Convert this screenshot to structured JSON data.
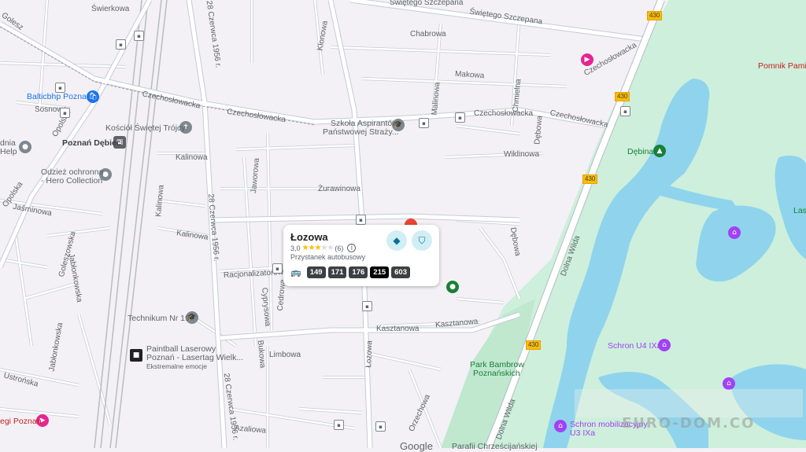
{
  "streets": {
    "swierkowa": "Świerkowa",
    "sw_szczepana_1": "Świętego Szczepana",
    "sw_szczepana_2": "Świętego Szczepana",
    "chabrowa": "Chabrowa",
    "klonowa": "Klonowa",
    "czerwca_top": "28 Czerwca 1956 r.",
    "makowa": "Makowa",
    "malinowa": "Malinowa",
    "chmielna": "Chmielna",
    "czechoslowacka_1": "Czechosłowacka",
    "czechoslowacka_2": "Czechosłowacka",
    "czechoslowacka_3": "Czechosłowacka",
    "czechoslowacka_4": "Czechosłowacka",
    "czechoslowacka_5": "Czechosłowacka",
    "sosnowa": "Sosnowa",
    "opolska_1": "Opolska",
    "opolska_2": "Opolska",
    "kalinowa_1": "Kalinowa",
    "kalinowa_2": "Kalinowa",
    "kalinowa_3": "Kalinowa",
    "jaworowa": "Jaworowa",
    "zurawinowa": "Żurawinowa",
    "wiklinowa": "Wiklinowa",
    "debowa_1": "Dębowa",
    "debowa_2": "Dębowa",
    "jasminowa": "Jaśminowa",
    "goleszowska": "Goleszowska",
    "jablonkowska_1": "Jabłonkowska",
    "jablonkowska_2": "Jabłonkowska",
    "czerwca_mid": "28 Czerwca 1956 r.",
    "czerwca_low": "28 Czerwca 1956 r.",
    "racjonalizatorow": "Racjonalizatorów",
    "cedrowa": "Cedrowa",
    "cyprysowa": "Cyprysowa",
    "kasztanowa_1": "Kasztanowa",
    "kasztanowa_2": "Kasztanowa",
    "lozowa_vertical": "Łozowa",
    "bukowa": "Bukowa",
    "limbowa": "Limbowa",
    "ustronska": "Ustrońska",
    "azaliowa": "Azaliowa",
    "orzechowa": "Orzechowa",
    "dolna_wilda_1": "Dolna Wilda",
    "dolna_wilda_2": "Dolna Wilda",
    "road_430_a": "430",
    "road_430_b": "430",
    "road_430_c": "430",
    "road_430_d": "430",
    "golesz_top": "Golesz"
  },
  "pois": {
    "balticbhp": "Balticbhp Poznań",
    "kosciol": "Kościół Świętej Trójcy",
    "poznan_debiec": "Poznań Dębiec",
    "odziez_1": "Odzież ochronna",
    "odziez_2": "- Hero Collection",
    "help_1": "dnia",
    "help_2": "Help",
    "szkola_1": "Szkoła Aspirantów",
    "szkola_2": "Państwowej Straży...",
    "pomnik": "Pomnik Pamię",
    "debina": "Dębina",
    "las": "Las",
    "technikum": "Technikum Nr 19",
    "paintball_1": "Paintball Laserowy",
    "paintball_2": "Poznań - Lasertag Wielk...",
    "paintball_3": "Ekstremalne emocje",
    "park_1": "Park Bambrow",
    "park_2": "Poznańskich",
    "schron_u4": "Schron U4 IXa",
    "schron_mob_1": "Schron mobilizacyjny",
    "schron_mob_2": "U3 IXa",
    "egi_poznan": "egi Poznań",
    "parafia": "Parafii Chrześcijańskiej"
  },
  "card": {
    "title": "Łozowa",
    "rating": "3,0",
    "stars_filled": 3,
    "stars_total": 5,
    "stars_filled_text": "★★★",
    "stars_empty_text": "★★",
    "reviews": "(6)",
    "type": "Przystanek autobusowy",
    "routes": [
      "149",
      "171",
      "176",
      "215",
      "603"
    ],
    "active_route": "215"
  },
  "watermark": "EURO-DOM.CO",
  "google": "Google",
  "colors": {
    "park": "#cdefdc",
    "water": "#8fd4ec",
    "road": "#ffffff",
    "road_casing": "#c6cbd2",
    "pin_red": "#ea4335",
    "route_chip": "#3c4043"
  }
}
